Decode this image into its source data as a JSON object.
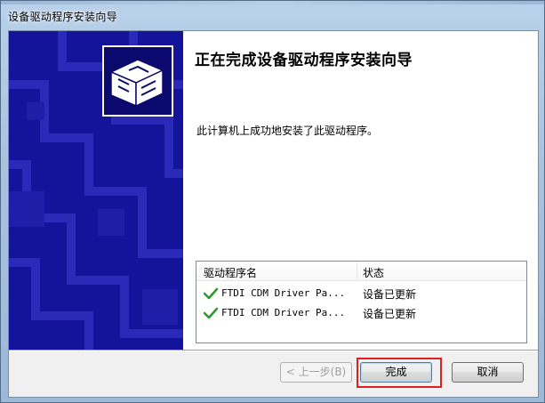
{
  "window": {
    "title": "设备驱动程序安装向导"
  },
  "wizard": {
    "heading": "正在完成设备驱动程序安装向导",
    "message": "此计算机上成功地安装了此驱动程序。"
  },
  "driver_list": {
    "columns": [
      "驱动程序名",
      "状态"
    ],
    "rows": [
      {
        "name": "FTDI CDM Driver Pa...",
        "status": "设备已更新",
        "icon": "green-check-icon"
      },
      {
        "name": "FTDI CDM Driver Pa...",
        "status": "设备已更新",
        "icon": "green-check-icon"
      }
    ]
  },
  "buttons": {
    "back": "< 上一步(B)",
    "finish": "完成",
    "cancel": "取消"
  },
  "colors": {
    "banner_bg": "#14149a",
    "check_green": "#2e9a2e",
    "highlight_red": "#e02020"
  }
}
